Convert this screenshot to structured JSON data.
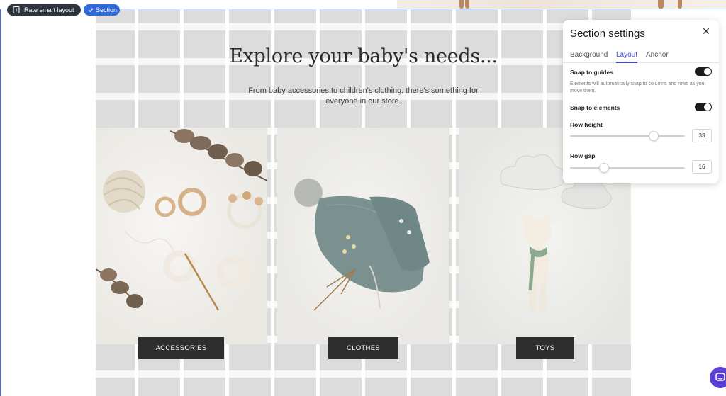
{
  "toolbar": {
    "rate_smart_layout": "Rate smart layout",
    "section_badge": "Section"
  },
  "main": {
    "headline": "Explore your baby's needs...",
    "subtext": "From baby accessories to children's clothing, there's something for everyone in our store.",
    "categories": [
      {
        "label": "ACCESSORIES",
        "image_icon": "crochet-accessories-photo"
      },
      {
        "label": "CLOTHES",
        "image_icon": "knit-baby-bonnet-photo"
      },
      {
        "label": "TOYS",
        "image_icon": "knitted-teddy-toy-photo"
      }
    ]
  },
  "panel": {
    "title": "Section settings",
    "tabs": [
      {
        "label": "Background",
        "active": false
      },
      {
        "label": "Layout",
        "active": true
      },
      {
        "label": "Anchor",
        "active": false
      }
    ],
    "snap_to_guides": {
      "label": "Snap to guides",
      "enabled": true
    },
    "snap_help": "Elements will automatically snap to columns and rows as you move them.",
    "snap_to_elements": {
      "label": "Snap to elements",
      "enabled": true
    },
    "row_height": {
      "label": "Row height",
      "value": "33",
      "level": 0.75
    },
    "row_gap": {
      "label": "Row gap",
      "value": "16",
      "level": 0.28
    }
  },
  "colors": {
    "accent_blue": "#2f6ad9",
    "active_tab": "#3b4bd6",
    "chat_purple": "#5b3fd6",
    "button_dark": "#2e2e2e"
  }
}
